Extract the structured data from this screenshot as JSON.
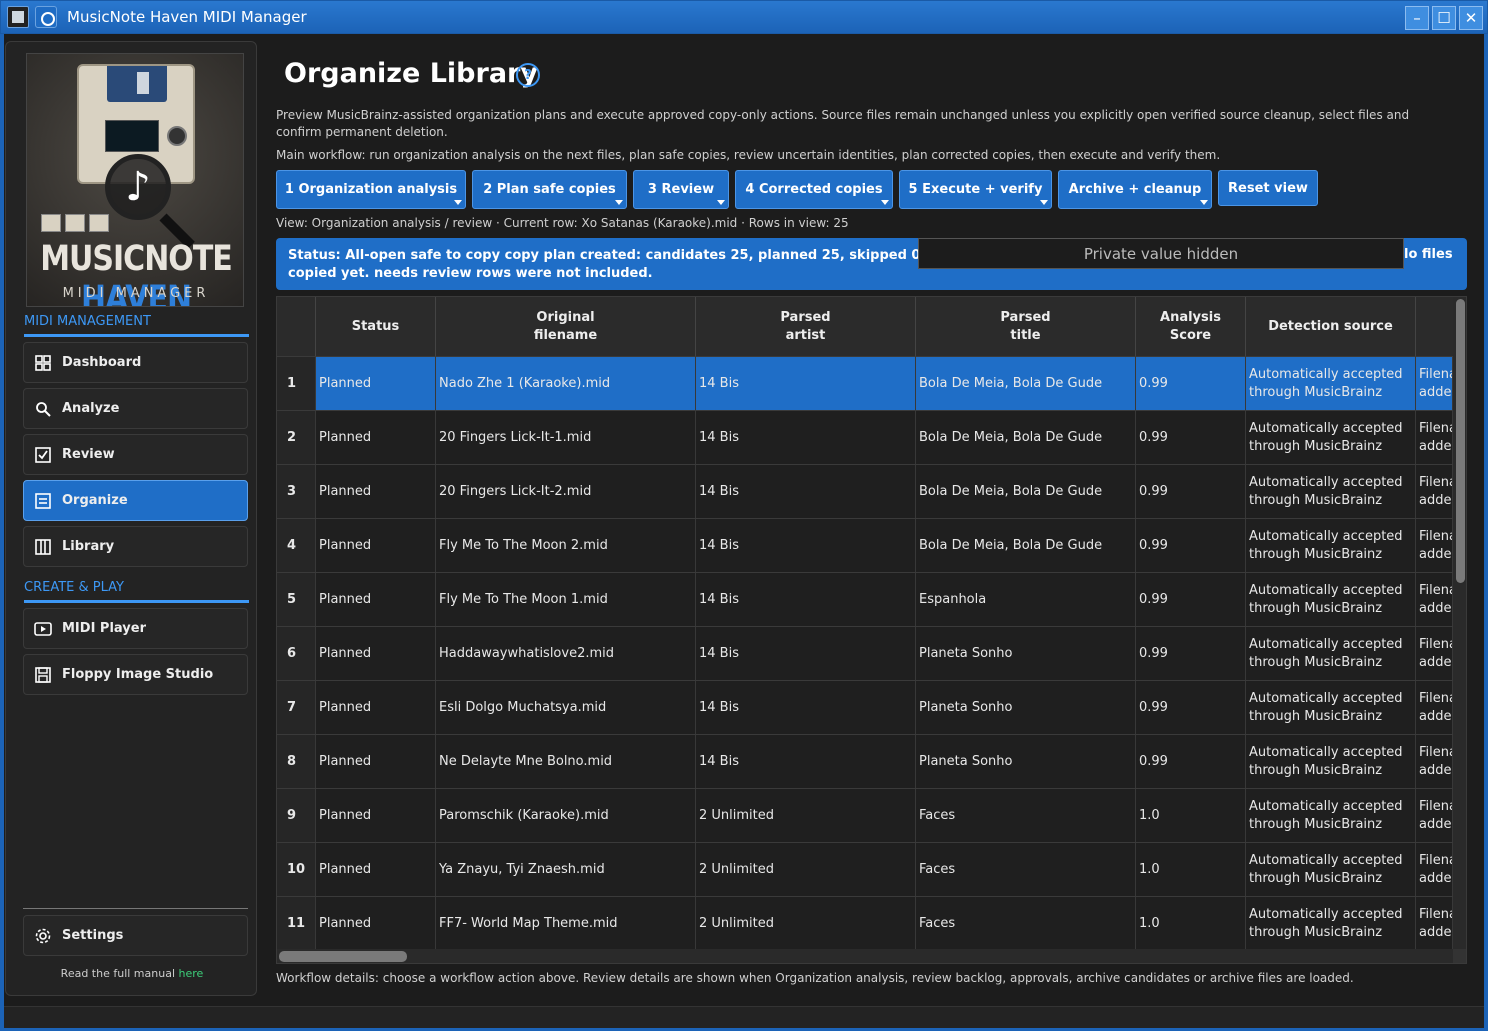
{
  "window": {
    "title": "MusicNote Haven MIDI Manager",
    "controls": [
      "minimize",
      "maximize",
      "close"
    ]
  },
  "logo": {
    "title_white": "MUSICNOTE",
    "title_blue": "HAVEN",
    "subtitle": "MIDI MANAGER"
  },
  "sidebar": {
    "section1": "MIDI MANAGEMENT",
    "section2": "CREATE & PLAY",
    "items": [
      {
        "label": "Dashboard",
        "icon": "dashboard-icon"
      },
      {
        "label": "Analyze",
        "icon": "search-icon"
      },
      {
        "label": "Review",
        "icon": "checkbox-icon"
      },
      {
        "label": "Organize",
        "icon": "organize-icon",
        "active": true
      },
      {
        "label": "Library",
        "icon": "library-icon"
      },
      {
        "label": "MIDI Player",
        "icon": "play-icon"
      },
      {
        "label": "Floppy Image Studio",
        "icon": "floppy-icon"
      }
    ],
    "settings": "Settings",
    "manual_text": "Read the full manual ",
    "manual_link": "here"
  },
  "main": {
    "title": "Organize Library",
    "help": "?",
    "desc1": "Preview MusicBrainz-assisted organization plans and execute approved copy-only actions. Source files remain unchanged unless you explicitly open verified source cleanup, select files and confirm permanent deletion.",
    "desc2": "Main workflow: run organization analysis on the next files, plan safe copies, review uncertain identities, plan corrected copies, then execute and verify them.",
    "workflow_buttons": [
      "1 Organization analysis",
      "2 Plan safe copies",
      "3 Review",
      "4 Corrected copies",
      "5 Execute + verify",
      "Archive + cleanup"
    ],
    "reset_button": "Reset view",
    "view_line": "View: Organization analysis / review · Current row: Xo Satanas (Karaoke).mid · Rows in view: 25",
    "status_line1": "Status: All-open safe to copy copy plan created: candidates 25, planned 25, skipped 0, failed 0. Targ",
    "status_line2": "copied yet. needs review rows were not included.",
    "status_tail": "lo files",
    "private_hidden": "Private value hidden",
    "footer": "Workflow details: choose a workflow action above. Review details are shown when Organization analysis, review backlog, approvals, archive candidates or archive files are loaded."
  },
  "table": {
    "headers": [
      "Status",
      "Original filename",
      "Parsed artist",
      "Parsed title",
      "Analysis Score",
      "Detection source",
      ""
    ],
    "header_lines": [
      [
        "Status"
      ],
      [
        "Original",
        "filename"
      ],
      [
        "Parsed",
        "artist"
      ],
      [
        "Parsed",
        "title"
      ],
      [
        "Analysis",
        "Score"
      ],
      [
        "Detection source"
      ],
      [
        ""
      ]
    ],
    "rows": [
      {
        "n": "1",
        "status": "Planned",
        "file": "Nado Zhe 1 (Karaoke).mid",
        "artist": "14 Bis",
        "title": "Bola De Meia, Bola De Gude",
        "score": "0.99",
        "source": "Automatically accepted through MusicBrainz",
        "extra": "Filena added",
        "selected": true
      },
      {
        "n": "2",
        "status": "Planned",
        "file": "20 Fingers Lick-It-1.mid",
        "artist": "14 Bis",
        "title": "Bola De Meia, Bola De Gude",
        "score": "0.99",
        "source": "Automatically accepted through MusicBrainz",
        "extra": "Filena added"
      },
      {
        "n": "3",
        "status": "Planned",
        "file": "20 Fingers Lick-It-2.mid",
        "artist": "14 Bis",
        "title": "Bola De Meia, Bola De Gude",
        "score": "0.99",
        "source": "Automatically accepted through MusicBrainz",
        "extra": "Filena added"
      },
      {
        "n": "4",
        "status": "Planned",
        "file": "Fly Me To The Moon 2.mid",
        "artist": "14 Bis",
        "title": "Bola De Meia, Bola De Gude",
        "score": "0.99",
        "source": "Automatically accepted through MusicBrainz",
        "extra": "Filena added"
      },
      {
        "n": "5",
        "status": "Planned",
        "file": "Fly Me To The Moon 1.mid",
        "artist": "14 Bis",
        "title": "Espanhola",
        "score": "0.99",
        "source": "Automatically accepted through MusicBrainz",
        "extra": "Filena added"
      },
      {
        "n": "6",
        "status": "Planned",
        "file": "Haddawaywhatislove2.mid",
        "artist": "14 Bis",
        "title": "Planeta Sonho",
        "score": "0.99",
        "source": "Automatically accepted through MusicBrainz",
        "extra": "Filena added"
      },
      {
        "n": "7",
        "status": "Planned",
        "file": "Esli Dolgo Muchatsya.mid",
        "artist": "14 Bis",
        "title": "Planeta Sonho",
        "score": "0.99",
        "source": "Automatically accepted through MusicBrainz",
        "extra": "Filena added"
      },
      {
        "n": "8",
        "status": "Planned",
        "file": "Ne Delayte Mne Bolno.mid",
        "artist": "14 Bis",
        "title": "Planeta Sonho",
        "score": "0.99",
        "source": "Automatically accepted through MusicBrainz",
        "extra": "Filena added"
      },
      {
        "n": "9",
        "status": "Planned",
        "file": "Paromschik (Karaoke).mid",
        "artist": "2 Unlimited",
        "title": "Faces",
        "score": "1.0",
        "source": "Automatically accepted through MusicBrainz",
        "extra": "Filena added"
      },
      {
        "n": "10",
        "status": "Planned",
        "file": "Ya Znayu, Tyi Znaesh.mid",
        "artist": "2 Unlimited",
        "title": "Faces",
        "score": "1.0",
        "source": "Automatically accepted through MusicBrainz",
        "extra": "Filena added"
      },
      {
        "n": "11",
        "status": "Planned",
        "file": "FF7- World Map Theme.mid",
        "artist": "2 Unlimited",
        "title": "Faces",
        "score": "1.0",
        "source": "Automatically accepted through MusicBrainz",
        "extra": "Filena added"
      }
    ]
  }
}
